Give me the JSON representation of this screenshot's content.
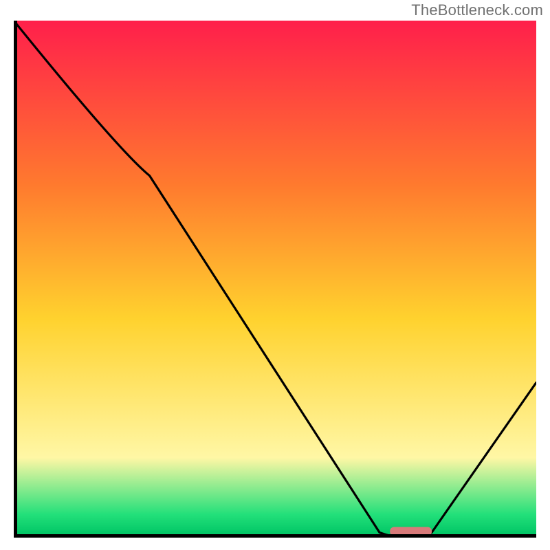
{
  "watermark": "TheBottleneck.com",
  "chart_data": {
    "type": "line",
    "title": "",
    "xlabel": "",
    "ylabel": "",
    "xlim": [
      0,
      100
    ],
    "ylim": [
      0,
      100
    ],
    "grid": false,
    "background_gradient": {
      "top": "#ff1f4b",
      "upper_mid": "#ff7a2e",
      "mid": "#ffd22e",
      "lower_mid": "#fff7a5",
      "bottom_band": "#23e07a",
      "bottom": "#00c565"
    },
    "curve": {
      "name": "bottleneck-curve",
      "color": "#000000",
      "points": [
        {
          "x": 0,
          "y": 100
        },
        {
          "x": 20,
          "y": 75
        },
        {
          "x": 26,
          "y": 70
        },
        {
          "x": 70,
          "y": 1
        },
        {
          "x": 75,
          "y": 0
        },
        {
          "x": 80,
          "y": 1
        },
        {
          "x": 100,
          "y": 30
        }
      ]
    },
    "marker": {
      "name": "optimal-marker",
      "shape": "rounded-bar",
      "color": "#d87a7a",
      "x_center": 76,
      "x_width": 8,
      "y": 1.2
    },
    "axes_color": "#000000",
    "axes_width": 4
  }
}
